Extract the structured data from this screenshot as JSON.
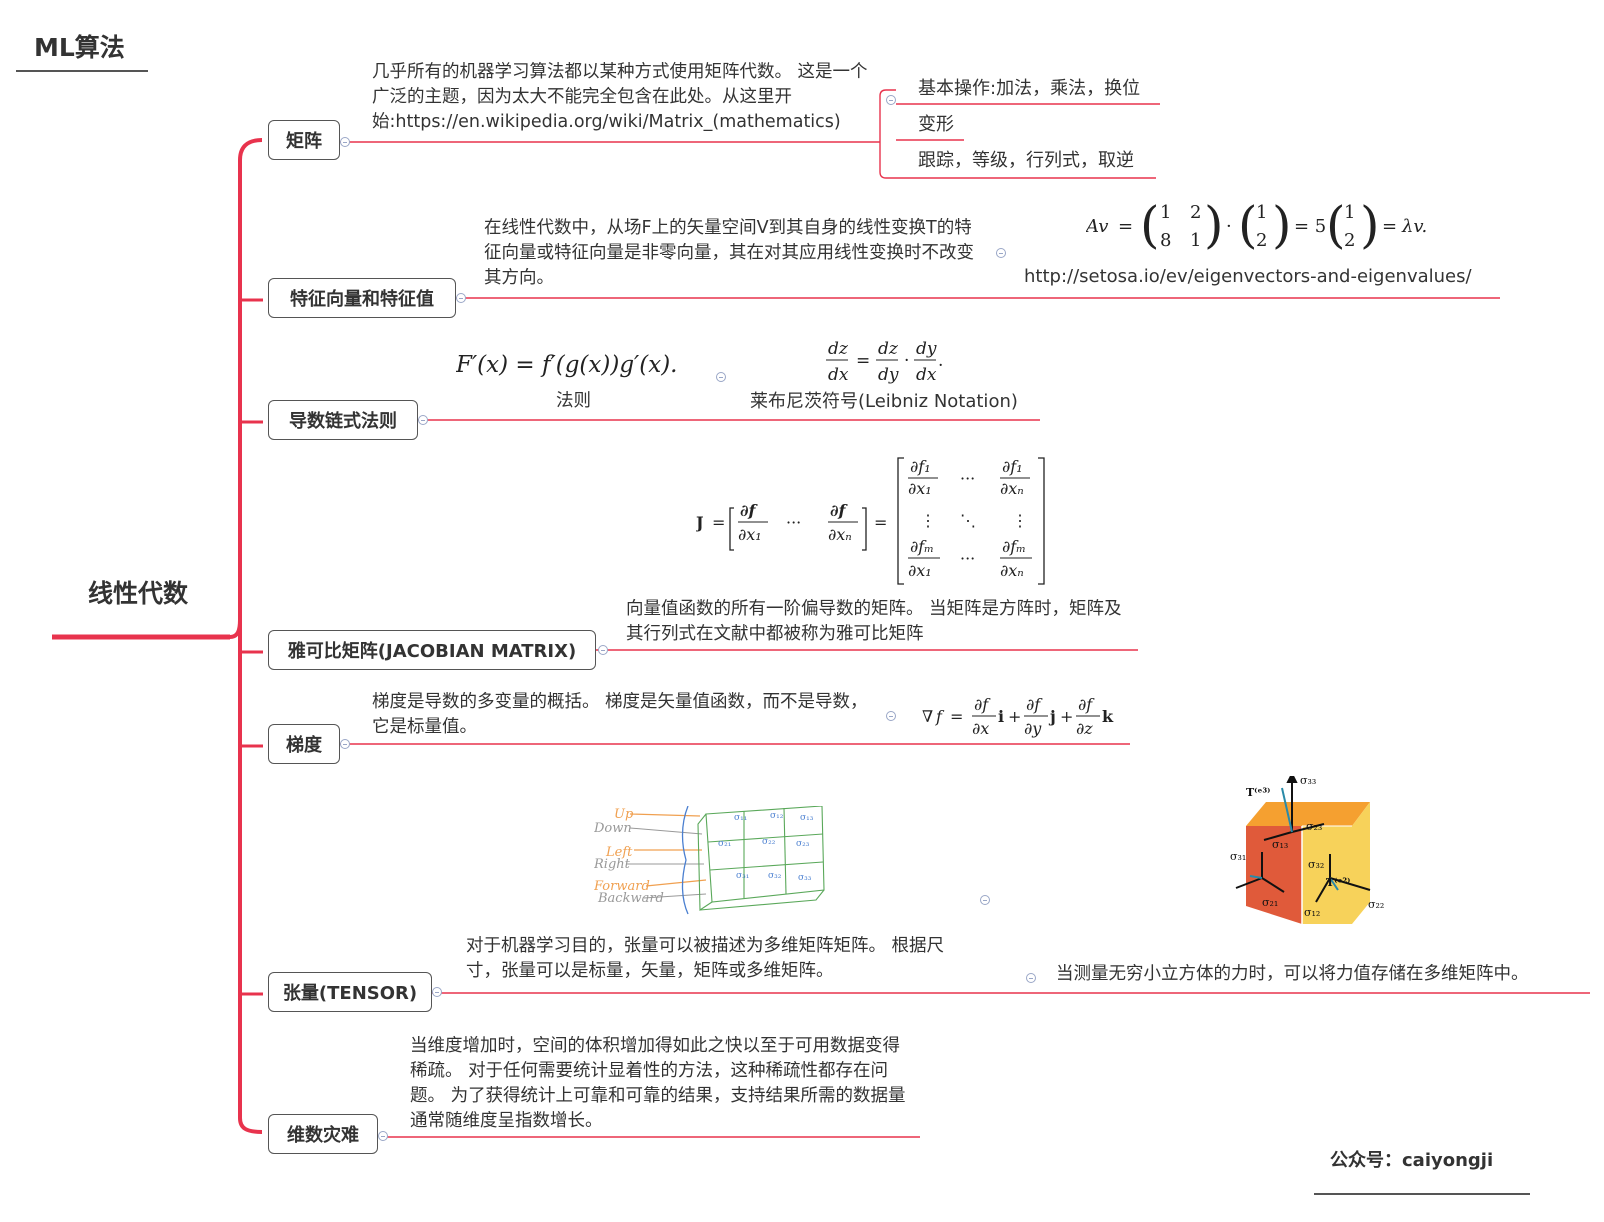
{
  "title": "ML算法",
  "root": "线性代数",
  "footer": "公众号：caiyongji",
  "colors": {
    "branch": "#e8334d",
    "gray": "#555555"
  },
  "branches": [
    {
      "name": "矩阵",
      "text": "几乎所有的机器学习算法都以某种方式使用矩阵代数。 这是一个广泛的主题，因为太大不能完全包含在此处。从这里开始:https://en.wikipedia.org/wiki/Matrix_(mathematics)",
      "children": [
        "基本操作:加法，乘法，换位",
        "变形",
        "跟踪，等级，行列式，取逆"
      ]
    },
    {
      "name": "特征向量和特征值",
      "text": "在线性代数中，从场F上的矢量空间V到其自身的线性变换T的特征向量或特征向量是非零向量，其在对其应用线性变换时不改变其方向。",
      "link": "http://setosa.io/ev/eigenvectors-and-eigenvalues/"
    },
    {
      "name": "导数链式法则",
      "label1": "法则",
      "label2": "莱布尼茨符号(Leibniz Notation)"
    },
    {
      "name": "雅可比矩阵(JACOBIAN MATRIX)",
      "text": "向量值函数的所有一阶偏导数的矩阵。 当矩阵是方阵时，矩阵及其行列式在文献中都被称为雅可比矩阵"
    },
    {
      "name": "梯度",
      "text": "梯度是导数的多变量的概括。 梯度是矢量值函数，而不是导数，它是标量值。"
    },
    {
      "name": "张量(TENSOR)",
      "text": "对于机器学习目的，张量可以被描述为多维矩阵矩阵。 根据尺寸，张量可以是标量，矢量，矩阵或多维矩阵。",
      "text2": "当测量无穷小立方体的力时，可以将力值存储在多维矩阵中。",
      "sketch": {
        "labels": [
          "Up",
          "Down",
          "Left",
          "Right",
          "Forward",
          "Backward"
        ]
      }
    },
    {
      "name": "维数灾难",
      "text": "当维度增加时，空间的体积增加得如此之快以至于可用数据变得稀疏。 对于任何需要统计显着性的方法，这种稀疏性都存在问题。 为了获得统计上可靠和可靠的结果，支持结果所需的数据量通常随维度呈指数增长。"
    }
  ]
}
